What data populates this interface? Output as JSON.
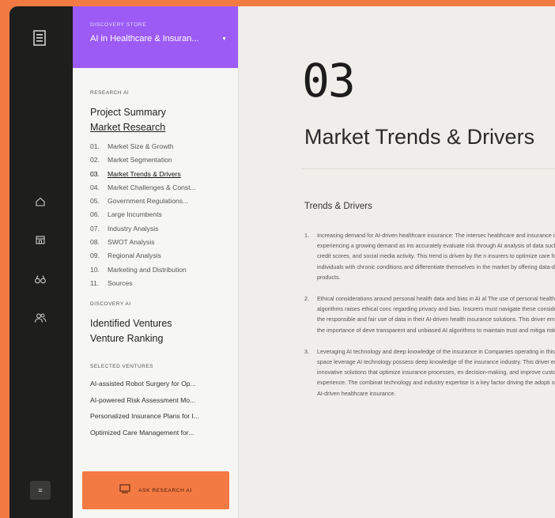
{
  "store": {
    "kicker": "DISCOVERY STORE",
    "name": "AI in Healthcare & Insuran..."
  },
  "research": {
    "label": "RESEARCH AI",
    "links": [
      "Project Summary",
      "Market Research"
    ],
    "toc": [
      {
        "num": "01.",
        "label": "Market Size & Growth"
      },
      {
        "num": "02.",
        "label": "Market Segmentation"
      },
      {
        "num": "03.",
        "label": "Market Trends & Drivers"
      },
      {
        "num": "04.",
        "label": "Market Challenges & Const..."
      },
      {
        "num": "05.",
        "label": "Government Regulations..."
      },
      {
        "num": "06.",
        "label": "Large Incumbents"
      },
      {
        "num": "07.",
        "label": "Industry Analysis"
      },
      {
        "num": "08.",
        "label": "SWOT Analysis"
      },
      {
        "num": "09.",
        "label": "Regional Analysis"
      },
      {
        "num": "10.",
        "label": "Marketing and Distribution"
      },
      {
        "num": "11.",
        "label": "Sources"
      }
    ]
  },
  "discovery": {
    "label": "DISCOVERY AI",
    "links": [
      "Identified Ventures",
      "Venture Ranking"
    ]
  },
  "selected": {
    "label": "SELECTED VENTURES",
    "items": [
      "AI-assisted Robot Surgery for Op...",
      "AI-powered Risk Assessment Mo...",
      "Personalized Insurance Plans for I...",
      "Optimized Care Management for..."
    ]
  },
  "ask_button": "ASK RESEARCH AI",
  "rail": {
    "icons": [
      "home-icon",
      "store-icon",
      "binoculars-icon",
      "users-icon"
    ],
    "bottom_label": "≡"
  },
  "main": {
    "number": "03",
    "title": "Market Trends & Drivers",
    "subhead": "Trends & Drivers",
    "drivers": [
      {
        "n": "1.",
        "text": "Increasing demand for AI-driven healthcare insurance: The intersec healthcare and insurance is experiencing a growing demand as ins accurately evaluate risk through AI analysis of data such as historic credit scores, and social media activity. This trend is driven by the n insurers to optimize care for individuals with chronic conditions and differentiate themselves in the market by offering data-driven insur products."
      },
      {
        "n": "2.",
        "text": "Ethical considerations around personal health data and bias in AI al The use of personal health data in AI algorithms raises ethical conc regarding privacy and bias. Insurers must navigate these considera ensure the responsible and fair use of data in their AI-driven health insurance solutions. This driver emphasizes the importance of deve transparent and unbiased AI algorithms to maintain trust and mitiga risks."
      },
      {
        "n": "3.",
        "text": "Leveraging AI technology and deep knowledge of the insurance in Companies operating in this problem space leverage AI technology possess deep knowledge of the insurance industry. This driver ena develop innovative solutions that optimize insurance processes, en decision-making, and improve customer experience. The combinat technology and industry expertise is a key factor driving the adopti success of AI-driven healthcare insurance."
      }
    ]
  },
  "colors": {
    "background": "#f47a43",
    "rail": "#1e1e1c",
    "store": "#9d5bf5",
    "ask_button": "#f47a43",
    "main_bg": "#efeeea"
  }
}
